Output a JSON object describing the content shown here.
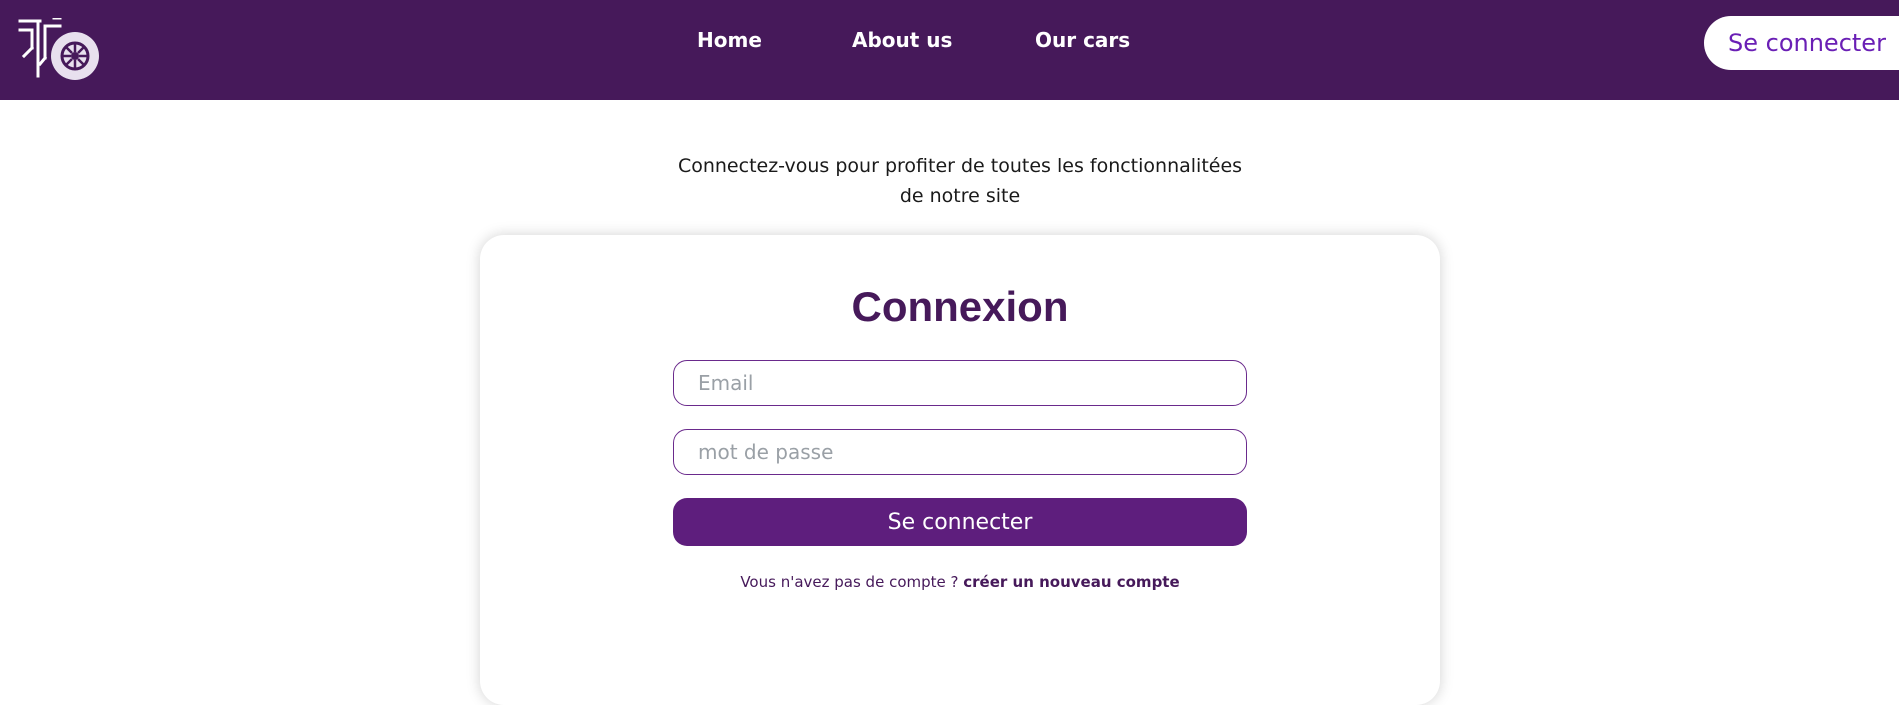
{
  "header": {
    "logo_icon": "wheel-logo-icon",
    "nav": {
      "home": "Home",
      "about": "About us",
      "cars": "Our cars"
    },
    "login_button": "Se connecter"
  },
  "intro": {
    "line1": "Connectez-vous pour profiter de toutes les fonctionnalitées",
    "line2": "de notre site"
  },
  "login_form": {
    "title": "Connexion",
    "email_placeholder": "Email",
    "password_placeholder": "mot de passe",
    "submit_label": "Se connecter",
    "signup_prompt": "Vous n'avez pas de compte ?",
    "signup_link": "créer un nouveau compte"
  },
  "colors": {
    "brand_purple": "#46195a",
    "button_purple": "#5e1e7d",
    "accent_text": "#6a1fb5"
  }
}
